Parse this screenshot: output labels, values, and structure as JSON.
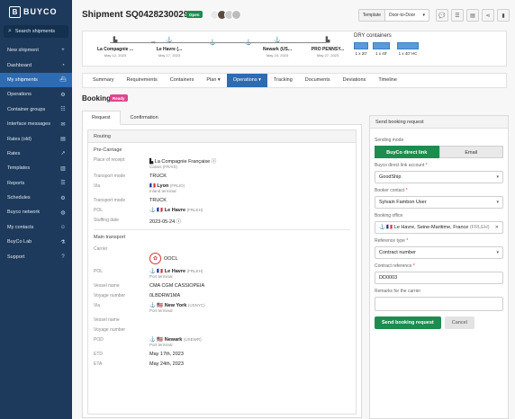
{
  "sidebar": {
    "logo_text": "BUYCO",
    "search_label": "Search shipments",
    "items": [
      {
        "label": "New shipment",
        "icon": "plus-icon",
        "glyph": "+"
      },
      {
        "label": "Dashboard",
        "icon": "gauge-icon",
        "glyph": "◔"
      },
      {
        "label": "My shipments",
        "icon": "ship-icon",
        "glyph": "⛴"
      },
      {
        "label": "Operations",
        "icon": "gear-icon",
        "glyph": "⚙"
      },
      {
        "label": "Container groups",
        "icon": "group-icon",
        "glyph": "☷"
      },
      {
        "label": "Interface messages",
        "icon": "message-icon",
        "glyph": "✉"
      },
      {
        "label": "Rates (old)",
        "icon": "rates-icon",
        "glyph": "▤"
      },
      {
        "label": "Rates",
        "icon": "chart-icon",
        "glyph": "↗"
      },
      {
        "label": "Templates",
        "icon": "template-icon",
        "glyph": "▥"
      },
      {
        "label": "Reports",
        "icon": "report-icon",
        "glyph": "☰"
      },
      {
        "label": "Schedules",
        "icon": "schedule-icon",
        "glyph": "⚙"
      },
      {
        "label": "Buyco network",
        "icon": "network-icon",
        "glyph": "◍"
      },
      {
        "label": "My contacts",
        "icon": "contacts-icon",
        "glyph": "☺"
      },
      {
        "label": "BuyCo Lab",
        "icon": "lab-icon",
        "glyph": "⚗"
      },
      {
        "label": "Support",
        "icon": "help-icon",
        "glyph": "?"
      }
    ]
  },
  "header": {
    "title": "Shipment SQ0428230029",
    "status": "Open",
    "template_label": "Template",
    "template_value": "Door-to-Door"
  },
  "route": {
    "stops": [
      {
        "name": "La Compagnie ...",
        "date": "May 12, 2023"
      },
      {
        "name": "Le Havre (...",
        "date": "May 17, 2023"
      },
      {
        "name": "Newark (US...",
        "date": "May 24, 2023"
      },
      {
        "name": "PRO PENNSY...",
        "date": "May 27, 2023"
      }
    ]
  },
  "containers": {
    "title": "DRY containers",
    "items": [
      {
        "label": "1 x 20'"
      },
      {
        "label": "1 x 40'"
      },
      {
        "label": "1 x 40' HC"
      }
    ]
  },
  "tabs": [
    "Summary",
    "Requirements",
    "Containers",
    "Plan",
    "Operations",
    "Tracking",
    "Documents",
    "Deviations",
    "Timeline"
  ],
  "booking": {
    "title": "Booking",
    "status": "Ready",
    "subtabs": [
      "Request",
      "Confirmation"
    ],
    "routing_title": "Routing",
    "pre_carriage": {
      "title": "Pre-Carriage",
      "place_of_receipt_label": "Place of receipt",
      "place_of_receipt": "La Compagnie Française",
      "place_of_receipt_sub": "Cassis (FRAIS)",
      "transport_mode_label": "Transport mode",
      "transport_mode": "TRUCK",
      "via_label": "Via",
      "via": "Lyon",
      "via_code": "(FRLIO)",
      "via_sub": "Inland terminal",
      "transport_mode2_label": "Transport mode",
      "transport_mode2": "TRUCK",
      "pol_label": "POL",
      "pol": "Le Havre",
      "pol_code": "(FRLEH)",
      "stuffing_label": "Stuffing date",
      "stuffing": "2023-05-24"
    },
    "main_transport": {
      "title": "Main transport",
      "carrier_label": "Carrier",
      "carrier": "OOCL",
      "pol_label": "POL",
      "pol": "Le Havre",
      "pol_code": "(FRLEH)",
      "pol_sub": "Port terminal",
      "vessel_label": "Vessel name",
      "vessel": "CMA CGM CASSIOPEIA",
      "voyage_label": "Voyage number",
      "voyage": "0LBDRW1MA",
      "via_label": "Via",
      "via": "New York",
      "via_code": "(USNYC)",
      "via_sub": "Port terminal",
      "vessel2_label": "Vessel name",
      "voyage2_label": "Voyage number",
      "pod_label": "POD",
      "pod": "Newark",
      "pod_code": "(USEWR)",
      "pod_sub": "Port terminal",
      "etd_label": "ETD",
      "etd": "May 17th, 2023",
      "eta_label": "ETA",
      "eta": "May 24th, 2023"
    }
  },
  "send_panel": {
    "title": "Send booking request",
    "sending_mode_label": "Sending mode",
    "mode_on": "BuyCo direct link",
    "mode_off": "Email",
    "direct_account_label": "Buyco direct link account",
    "direct_account": "GoodShip",
    "booker_label": "Booker contact",
    "booker": "Sylvain Fambon User",
    "booking_office_label": "Booking office",
    "booking_office": "Le Havre, Seine-Maritime, France",
    "booking_office_code": "(FRLEH)",
    "ref_type_label": "Reference type",
    "ref_type": "Contract number",
    "contract_ref_label": "Contract reference",
    "contract_ref": "DD0003",
    "remarks_label": "Remarks for the carrier",
    "send_button": "Send booking request",
    "cancel_button": "Cancel"
  }
}
